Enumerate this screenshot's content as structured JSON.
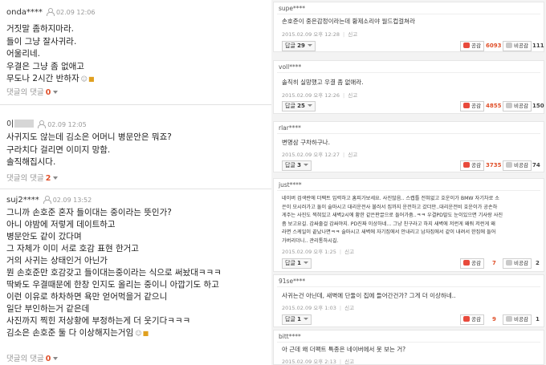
{
  "left_comments": [
    {
      "user": "onda****",
      "date": "02.09 12:06",
      "lines": [
        "거짓말 좀하지마라.",
        "들이 그냥 잘사귀라.",
        "어울리네.",
        "우결은 그냥 좀 없애고",
        "무도나 2시간 반하자"
      ],
      "reply_label": "댓글의 댓글",
      "reply_count": "0"
    },
    {
      "user": "이",
      "date": "02.09 12:05",
      "lines": [
        "사귀지도 않는데 김소은 어머니 병문안은 뭐죠?",
        "구라치다 걸리면 이미지 망함.",
        "솔직해집시다."
      ],
      "reply_label": "댓글의 댓글",
      "reply_count": "2"
    },
    {
      "user": "suj2****",
      "date": "02.09 13:52",
      "lines": [
        "그니까 손호준 혼자 들이대는 중이라는 뜻인가?",
        "아니 야밤에 저렇게 데이트하고",
        "병문안도 같이 갔다며",
        "그 자체가 이미 서로 호감 표현 한거고",
        "거의 사귀는 상태인거 아닌가",
        "뭔 손호준만 호감갖고 들이대는중이라는 식으로 써놨대ㅋㅋㅋ",
        "딱봐도 우결때문에 한창 인지도 올리는 중이니 아깝기도 하고",
        "이런 이유로 하차하면 욕만 얻어먹을거 같으니",
        "일단 부인하는거 같은데",
        "사진까지 찍힌 저상황에 부정하는게 더 웃기다ㅋㅋㅋ",
        "김소은 손호준 둘 다 이상해지는거임"
      ],
      "reply_label": "댓글의 댓글",
      "reply_count": "0"
    }
  ],
  "right_comments": [
    {
      "user": "supe****",
      "text": [
        "손호준이 중은감정이라는데 황제소리야 월드컵걸쳐라"
      ],
      "date": "2015.02.09 오후 12:28",
      "report": "신고",
      "reply_label": "답글",
      "reply_count": "29",
      "like_label": "공감",
      "like_count": "6093",
      "dislike_label": "비공감",
      "dislike_count": "111"
    },
    {
      "user": "voll****",
      "text": [
        "솔직히 실망했고 우결 좀 없애라."
      ],
      "date": "2015.02.09 오후 12:26",
      "report": "신고",
      "reply_label": "답글",
      "reply_count": "25",
      "like_label": "공감",
      "like_count": "4855",
      "dislike_label": "비공감",
      "dislike_count": "150"
    },
    {
      "user": "rlar****",
      "text": [
        "변명삼 구차하구나."
      ],
      "date": "2015.02.09 오후 12:27",
      "report": "신고",
      "reply_label": "답글",
      "reply_count": "3",
      "like_label": "공감",
      "like_count": "3735",
      "dislike_label": "비공감",
      "dislike_count": "74"
    },
    {
      "user": "just****",
      "text": [
        "네이버 검색란에 더팩트 입력하고 홈피가보세요. 사진많음.. 스캡틀 전혀없고 호운이가 BMW 자기차로 소",
        "은이 모시러가고 둘이 술마시고 대리운전사 불러서 집까지 운전하고 갔더만..대리운전비 호운이가 공손하",
        "게주는 사진도 찍혀있고 새벽2시에 황한 같은판끌으로 들어가줌..ㅋㅋ 우결PD말도 눈이있으면 기사랑 사진",
        "좀 보고요길. 감싸줄걸 감싸야지. PD진짜 이상하네... 그냥 친구라고 하지 새벽에 저런게 왜줘 저런게 왜",
        "라면 스케일이 끝났나면ㅋㅋ 술마시고 새벽에 자기집에서 안내리고 남자집에서 같이 내려서 한집에 들어",
        "가버리더니.. 관리통하시길."
      ],
      "date": "2015.02.09 오후 1:25",
      "report": "신고",
      "reply_label": "답글",
      "reply_count": "1",
      "like_label": "공감",
      "like_count": "7",
      "dislike_label": "비공감",
      "dislike_count": "2"
    },
    {
      "user": "91se****",
      "text": [
        "사귀는건 아닌데, 새벽에 단둘이 집에 들어간건가? 그게 더 이상하네.."
      ],
      "date": "2015.02.09 오후 1:03",
      "report": "신고",
      "reply_label": "답글",
      "reply_count": "1",
      "like_label": "공감",
      "like_count": "9",
      "dislike_label": "비공감",
      "dislike_count": "1"
    },
    {
      "user": "bitt****",
      "text": [
        "아 근데 왜 더팩트 특종은 네이버에서 못 보는 거?"
      ],
      "date": "2015.02.09 오후 2:13",
      "report": "신고",
      "reply_label": "",
      "reply_count": "",
      "like_label": "",
      "like_count": "",
      "dislike_label": "",
      "dislike_count": ""
    }
  ]
}
